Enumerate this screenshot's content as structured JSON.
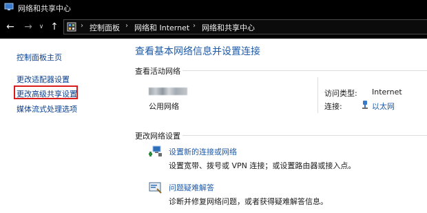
{
  "window": {
    "title": "网络和共享中心"
  },
  "nav": {
    "back": "←",
    "forward": "→",
    "recent": "∨",
    "up": "↑",
    "breadcrumbs": [
      "控制面板",
      "网络和 Internet",
      "网络和共享中心"
    ],
    "separator": "›"
  },
  "sidebar": {
    "items": [
      {
        "label": "控制面板主页"
      },
      {
        "label": "更改适配器设置"
      },
      {
        "label": "更改高级共享设置",
        "highlighted": true
      },
      {
        "label": "媒体流式处理选项"
      }
    ],
    "highlight_color": "#d81c1c"
  },
  "main": {
    "title": "查看基本网络信息并设置连接",
    "active_networks": {
      "heading": "查看活动网络",
      "network_type": "公用网络",
      "access_type_label": "访问类型:",
      "access_type_value": "Internet",
      "connection_label": "连接:",
      "connection_value": "以太网"
    },
    "change_settings": {
      "heading": "更改网络设置",
      "tasks": [
        {
          "icon": "network-setup-icon",
          "link": "设置新的连接或网络",
          "desc": "设置宽带、拨号或 VPN 连接；或设置路由器或接入点。"
        },
        {
          "icon": "troubleshoot-icon",
          "link": "问题疑难解答",
          "desc": "诊断并修复网络问题，或者获得疑难解答信息。"
        }
      ]
    }
  },
  "colors": {
    "link": "#1e5aa8",
    "sidebar_link": "#0b3f8c",
    "chrome": "#000000"
  }
}
